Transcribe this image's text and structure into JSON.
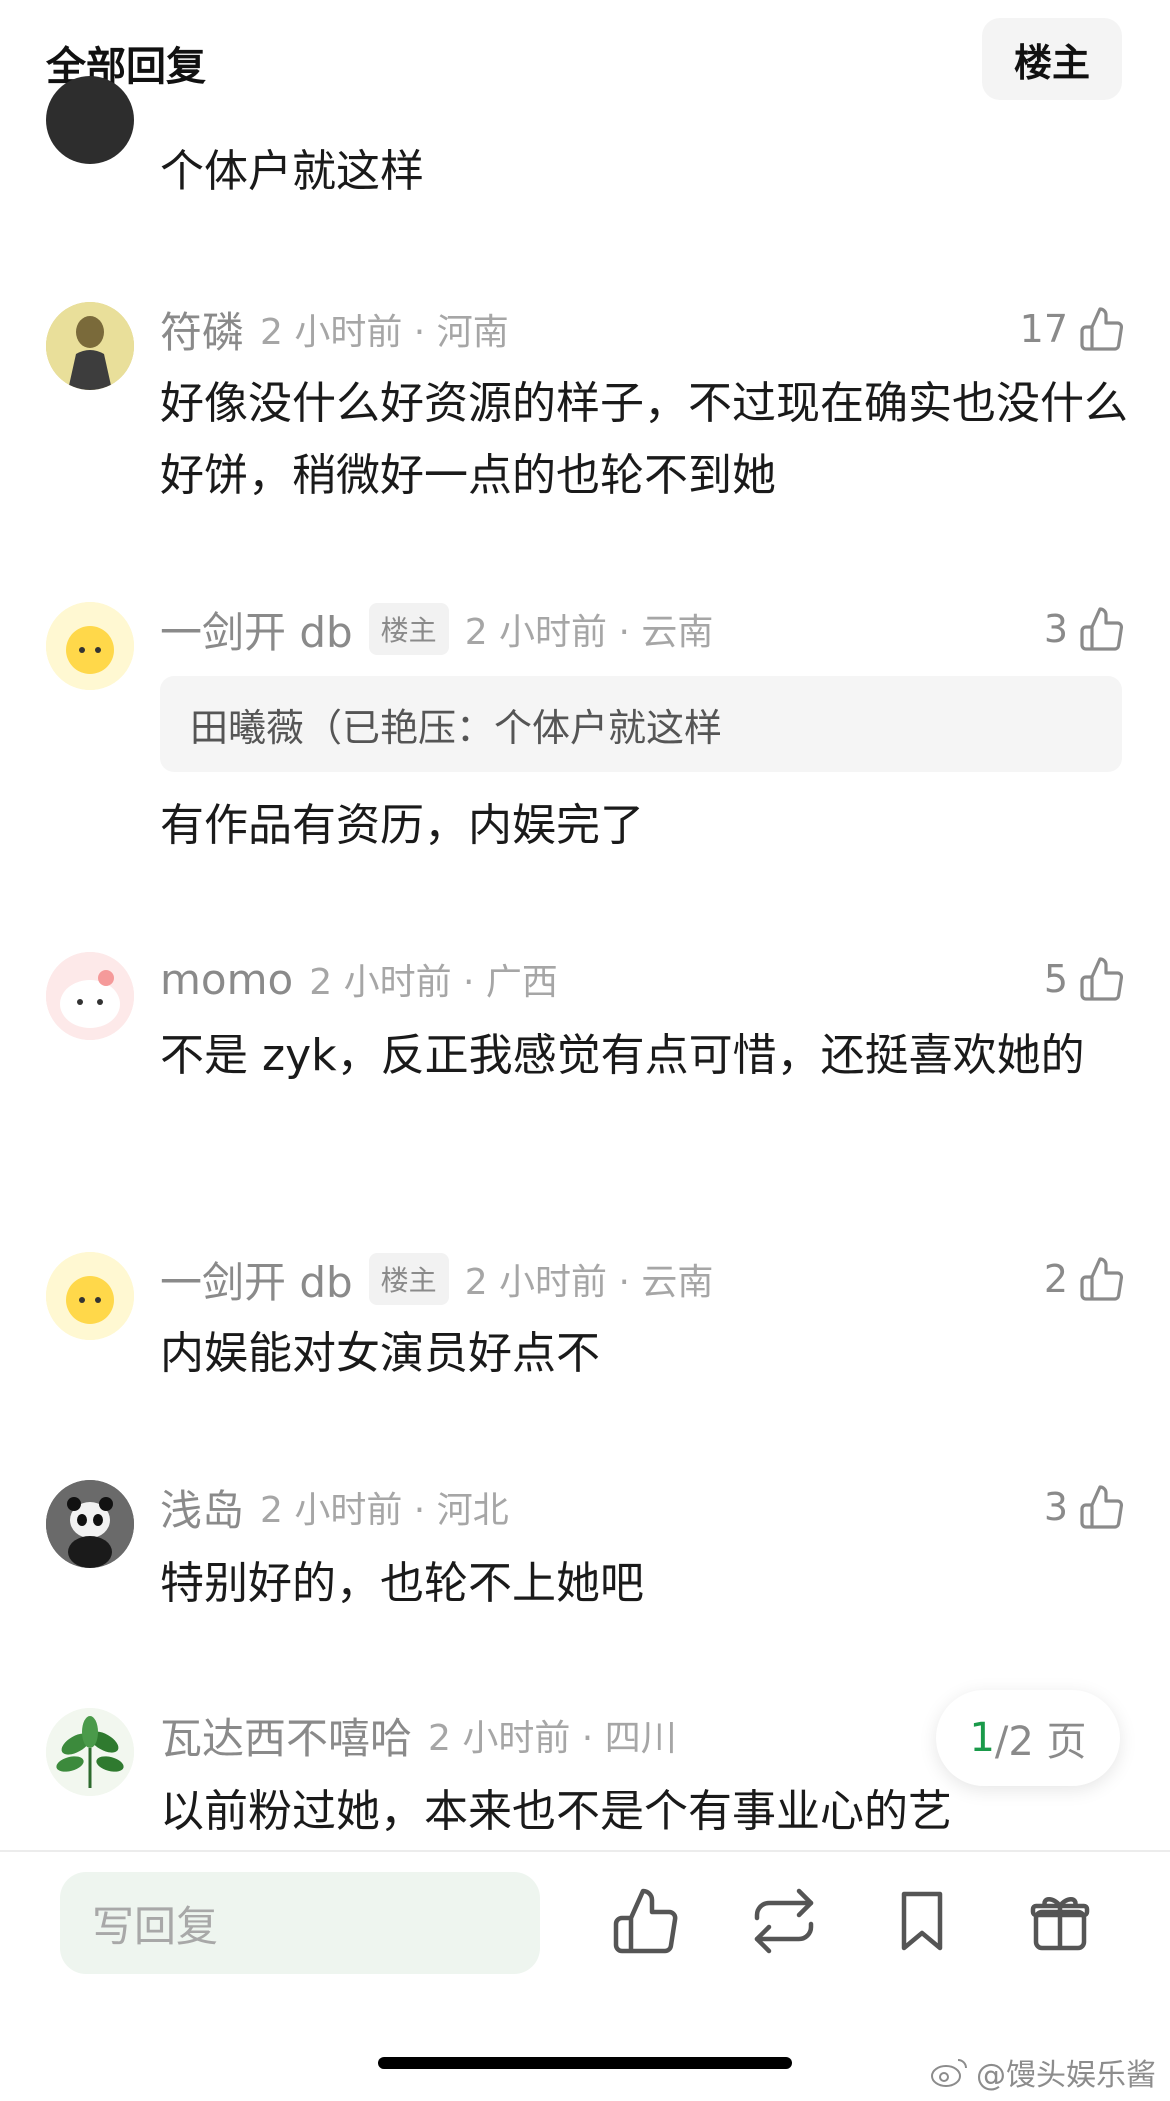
{
  "header": {
    "title": "全部回复",
    "op_filter": "楼主"
  },
  "comments": [
    {
      "text": "个体户就这样"
    },
    {
      "nick": "符磷",
      "time": "2 小时前 · 河南",
      "likes": "17",
      "text": "好像没什么好资源的样子，不过现在确实也没什么好饼，稍微好一点的也轮不到她"
    },
    {
      "nick": "一剑开 db",
      "op_tag": "楼主",
      "time": "2 小时前 · 云南",
      "likes": "3",
      "quote": "田曦薇（已艳压：个体户就这样",
      "text": "有作品有资历，内娱完了"
    },
    {
      "nick": "momo",
      "time": "2 小时前 · 广西",
      "likes": "5",
      "text": "不是 zyk，反正我感觉有点可惜，还挺喜欢她的"
    },
    {
      "nick": "一剑开 db",
      "op_tag": "楼主",
      "time": "2 小时前 · 云南",
      "likes": "2",
      "text": "内娱能对女演员好点不"
    },
    {
      "nick": "浅岛",
      "time": "2 小时前 · 河北",
      "likes": "3",
      "text": "特别好的，也轮不上她吧"
    },
    {
      "nick": "瓦达西不嘻哈",
      "time": "2 小时前 · 四川",
      "text": "以前粉过她，本来也不是个有事业心的艺"
    }
  ],
  "pagination": {
    "current": "1",
    "total_label": "/2 页"
  },
  "bottom_bar": {
    "reply_placeholder": "写回复",
    "icons": [
      "thumbs-up-icon",
      "repost-icon",
      "bookmark-icon",
      "gift-icon"
    ]
  },
  "watermark": "@馒头娱乐酱",
  "colors": {
    "accent_green": "#1a9a4a",
    "reply_box_bg": "#eef5ef",
    "muted_text": "#8a8a8a"
  }
}
